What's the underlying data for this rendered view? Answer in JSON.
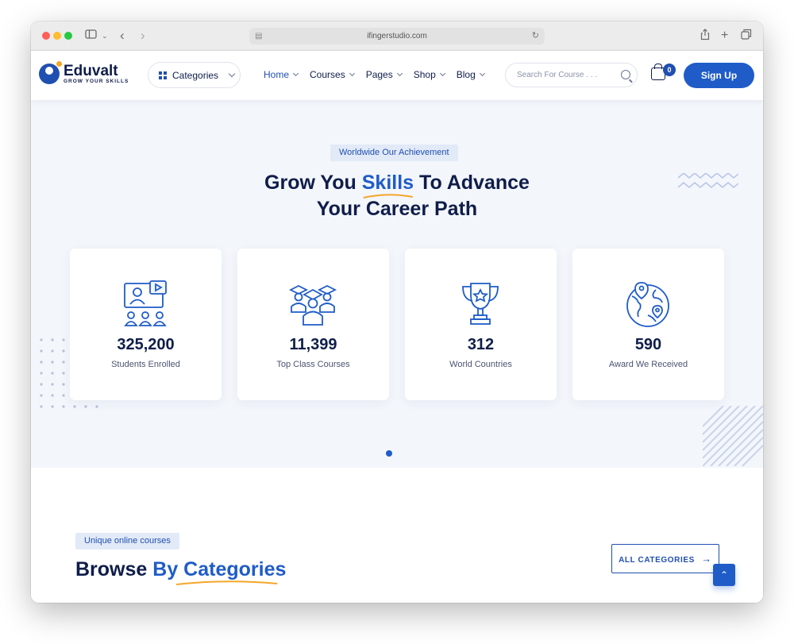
{
  "browser": {
    "url": "ifingerstudio.com",
    "icons": [
      "sidebar-icon",
      "back-icon",
      "forward-icon",
      "share-icon",
      "new-tab-icon",
      "tabs-icon"
    ]
  },
  "header": {
    "logo_name": "Eduvalt",
    "logo_tagline": "GROW YOUR SKILLS",
    "categories_label": "Categories",
    "nav": [
      {
        "label": "Home"
      },
      {
        "label": "Courses"
      },
      {
        "label": "Pages"
      },
      {
        "label": "Shop"
      },
      {
        "label": "Blog"
      }
    ],
    "search_placeholder": "Search For Course . . .",
    "cart_count": "0",
    "signup_label": "Sign Up"
  },
  "achievements": {
    "badge": "Worldwide Our Achievement",
    "title_part1": "Grow You ",
    "title_accent": "Skills",
    "title_part2": " To Advance",
    "title_line2": "Your Career Path",
    "stats": [
      {
        "value": "325,200",
        "label": "Students Enrolled",
        "icon": "classroom-icon"
      },
      {
        "value": "11,399",
        "label": "Top Class Courses",
        "icon": "graduates-icon"
      },
      {
        "value": "312",
        "label": "World Countries",
        "icon": "trophy-icon"
      },
      {
        "value": "590",
        "label": "Award We Received",
        "icon": "globe-icon"
      }
    ]
  },
  "categories": {
    "badge": "Unique online courses",
    "title_part1": "Browse ",
    "title_accent": "By Categories",
    "all_label": "ALL CATEGORIES",
    "accent_color": "#1f5cc8",
    "underline_color": "#f4a62a"
  }
}
